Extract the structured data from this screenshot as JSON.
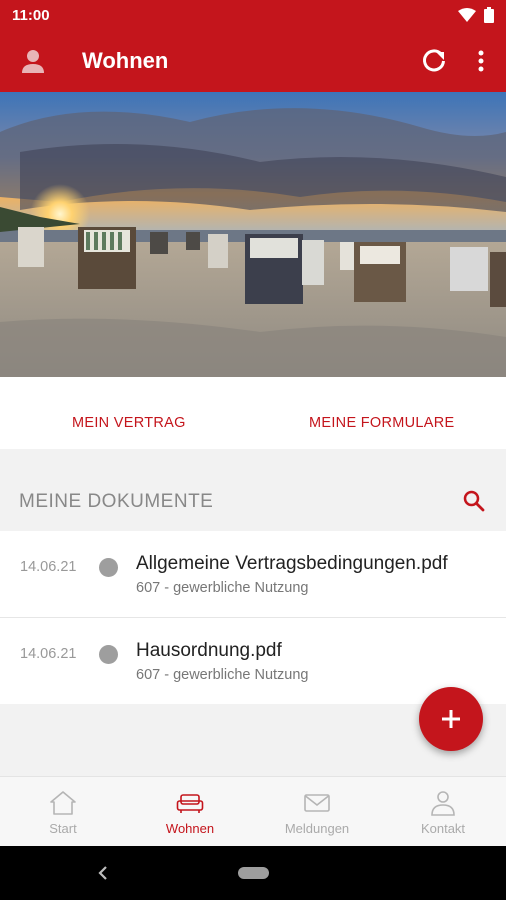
{
  "status": {
    "time": "11:00"
  },
  "appbar": {
    "title": "Wohnen"
  },
  "actions": {
    "vertrag": "MEIN VERTRAG",
    "formulare": "MEINE FORMULARE"
  },
  "documents": {
    "header": "MEINE DOKUMENTE",
    "items": [
      {
        "date": "14.06.21",
        "name": "Allgemeine Vertragsbedingungen.pdf",
        "subtitle": "607 - gewerbliche Nutzung"
      },
      {
        "date": "14.06.21",
        "name": "Hausordnung.pdf",
        "subtitle": "607 - gewerbliche Nutzung"
      }
    ]
  },
  "bottom_nav": {
    "items": [
      {
        "label": "Start",
        "icon": "home-icon"
      },
      {
        "label": "Wohnen",
        "icon": "sofa-icon",
        "active": true
      },
      {
        "label": "Meldungen",
        "icon": "mail-icon"
      },
      {
        "label": "Kontakt",
        "icon": "person-icon"
      }
    ]
  },
  "colors": {
    "accent": "#c4151c",
    "background": "#f2f2f2"
  }
}
